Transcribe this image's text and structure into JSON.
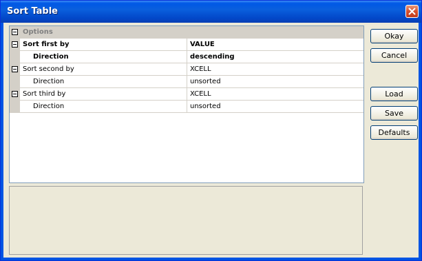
{
  "window": {
    "title": "Sort Table"
  },
  "grid": {
    "category_label": "Options",
    "rows": [
      {
        "name": "Sort first by",
        "value": "VALUE",
        "bold": true
      },
      {
        "name": "Direction",
        "value": "descending",
        "bold": true
      },
      {
        "name": "Sort second by",
        "value": "XCELL",
        "bold": false
      },
      {
        "name": "Direction",
        "value": "unsorted",
        "bold": false
      },
      {
        "name": "Sort third by",
        "value": "XCELL",
        "bold": false
      },
      {
        "name": "Direction",
        "value": "unsorted",
        "bold": false
      }
    ]
  },
  "buttons": {
    "okay": "Okay",
    "cancel": "Cancel",
    "load": "Load",
    "save": "Save",
    "defaults": "Defaults"
  },
  "icons": {
    "close": "close-icon",
    "expand": "collapse-icon"
  }
}
